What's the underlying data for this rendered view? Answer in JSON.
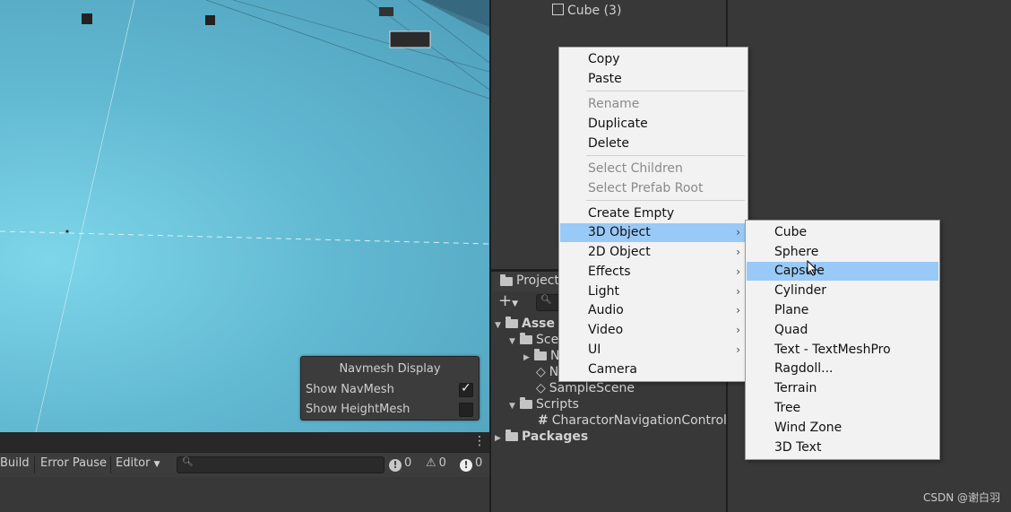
{
  "scene": {
    "navmesh_panel": {
      "title": "Navmesh Display",
      "show_navmesh": "Show NavMesh",
      "show_heightmesh": "Show HeightMesh",
      "show_navmesh_checked": true,
      "show_heightmesh_checked": false
    },
    "toolbar": {
      "build": "Build",
      "error_pause": "Error Pause",
      "editor": "Editor",
      "log_count": "0",
      "warning_count": "0",
      "error_count": "0"
    }
  },
  "hierarchy": {
    "item": "Cube (3)"
  },
  "project": {
    "tab": "Project",
    "tree": {
      "assets": "Asse",
      "scenes": "Sce",
      "sub1": "N",
      "sub2": "N",
      "sample_scene": "SampleScene",
      "scripts": "Scripts",
      "script_file": "CharactorNavigationControl",
      "packages": "Packages"
    }
  },
  "context_menu": {
    "items": [
      {
        "label": "Copy",
        "enabled": true
      },
      {
        "label": "Paste",
        "enabled": true
      },
      {
        "label": "Rename",
        "enabled": false
      },
      {
        "label": "Duplicate",
        "enabled": true
      },
      {
        "label": "Delete",
        "enabled": true
      },
      {
        "label": "Select Children",
        "enabled": false
      },
      {
        "label": "Select Prefab Root",
        "enabled": false
      },
      {
        "label": "Create Empty",
        "enabled": true
      },
      {
        "label": "3D Object",
        "enabled": true,
        "submenu": true,
        "highlighted": true
      },
      {
        "label": "2D Object",
        "enabled": true,
        "submenu": true
      },
      {
        "label": "Effects",
        "enabled": true,
        "submenu": true
      },
      {
        "label": "Light",
        "enabled": true,
        "submenu": true
      },
      {
        "label": "Audio",
        "enabled": true,
        "submenu": true
      },
      {
        "label": "Video",
        "enabled": true,
        "submenu": true
      },
      {
        "label": "UI",
        "enabled": true,
        "submenu": true
      },
      {
        "label": "Camera",
        "enabled": true
      }
    ]
  },
  "submenu_3d": {
    "items": [
      {
        "label": "Cube"
      },
      {
        "label": "Sphere"
      },
      {
        "label": "Capsule",
        "highlighted": true
      },
      {
        "label": "Cylinder"
      },
      {
        "label": "Plane"
      },
      {
        "label": "Quad"
      },
      {
        "label": "Text - TextMeshPro"
      },
      {
        "label": "Ragdoll..."
      },
      {
        "label": "Terrain"
      },
      {
        "label": "Tree"
      },
      {
        "label": "Wind Zone"
      },
      {
        "label": "3D Text"
      }
    ]
  },
  "watermark": "CSDN @谢白羽",
  "colors": {
    "menu_highlight": "#99c9f7",
    "scene_sky": "#62b9d2",
    "panel_bg": "#383838"
  }
}
